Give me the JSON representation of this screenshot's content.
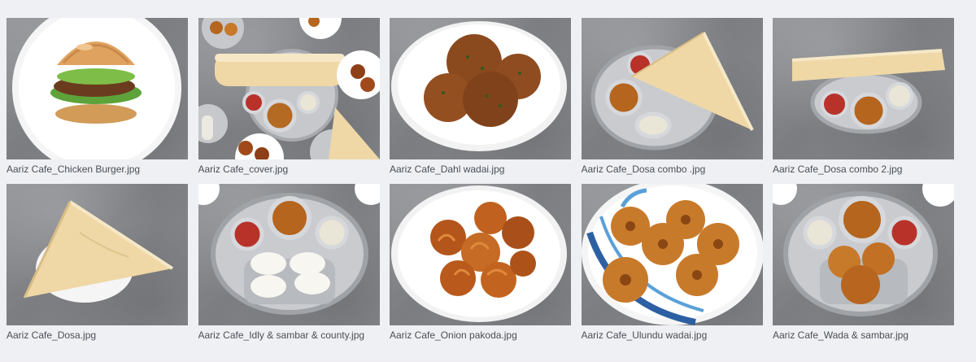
{
  "gallery": {
    "items": [
      {
        "filename": "Aariz Cafe_Chicken Burger.jpg",
        "subject": "chicken-burger"
      },
      {
        "filename": "Aariz Cafe_cover.jpg",
        "subject": "cover-spread"
      },
      {
        "filename": "Aariz Cafe_Dahl wadai.jpg",
        "subject": "dahl-wadai"
      },
      {
        "filename": "Aariz Cafe_Dosa combo .jpg",
        "subject": "dosa-combo"
      },
      {
        "filename": "Aariz Cafe_Dosa combo 2.jpg",
        "subject": "dosa-combo-2"
      },
      {
        "filename": "Aariz Cafe_Dosa.jpg",
        "subject": "dosa"
      },
      {
        "filename": "Aariz Cafe_Idly & sambar & county.jpg",
        "subject": "idly-sambar"
      },
      {
        "filename": "Aariz Cafe_Onion pakoda.jpg",
        "subject": "onion-pakoda"
      },
      {
        "filename": "Aariz Cafe_Ulundu wadai.jpg",
        "subject": "ulundu-wadai"
      },
      {
        "filename": "Aariz Cafe_Wada & sambar.jpg",
        "subject": "wada-sambar"
      }
    ]
  },
  "colors": {
    "background": "#eef0f3",
    "caption": "#4a4f57",
    "plate": "#ffffff",
    "steel": "#b9bcc0",
    "fried": "#9a4a1c",
    "dosa": "#efd8a6",
    "sambar": "#b5651d",
    "chutney_red": "#b8322a",
    "chutney_white": "#e9e6d8"
  }
}
